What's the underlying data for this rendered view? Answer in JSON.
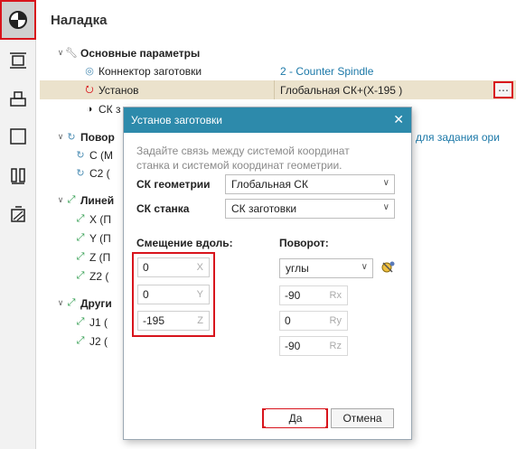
{
  "panel": {
    "title": "Наладка"
  },
  "tree": {
    "main_params": "Основные параметры",
    "connector": {
      "label": "Коннектор заготовки",
      "value": "2 - Counter Spindle"
    },
    "setup": {
      "label": "Установ",
      "value": "Глобальная СК+(X-195 )"
    },
    "cs_row": "СК з",
    "rotary_group": "Повор",
    "rotary_right_text": "для задания ори",
    "c_item": "C (M",
    "c2_item": "C2 (",
    "linear_group": "Линей",
    "x_item": "X (П",
    "y_item": "Y (П",
    "z_item": "Z (П",
    "z2_item": "Z2 (",
    "other_group": "Други",
    "j1_item": "J1 (",
    "j2_item": "J2 ("
  },
  "dialog": {
    "title": "Установ заготовки",
    "hint": "Задайте связь между системой координат станка и системой координат геометрии.",
    "geom_cs_label": "СК геометрии",
    "geom_cs_value": "Глобальная СК",
    "machine_cs_label": "СК станка",
    "machine_cs_value": "СК заготовки",
    "offset_label": "Смещение вдоль:",
    "offset": {
      "x": "0",
      "y": "0",
      "z": "-195"
    },
    "axis_x": "X",
    "axis_y": "Y",
    "axis_z": "Z",
    "rotation_label": "Поворот:",
    "rotation_mode": "углы",
    "rotation": {
      "rx": "-90",
      "ry": "0",
      "rz": "-90"
    },
    "axis_rx": "Rx",
    "axis_ry": "Ry",
    "axis_rz": "Rz",
    "ok_label": "Да",
    "cancel_label": "Отмена"
  },
  "colors": {
    "accent": "#2d8aab",
    "highlight": "#d8141c",
    "link": "#1b78a8",
    "selected_row": "#ebe2cc"
  }
}
